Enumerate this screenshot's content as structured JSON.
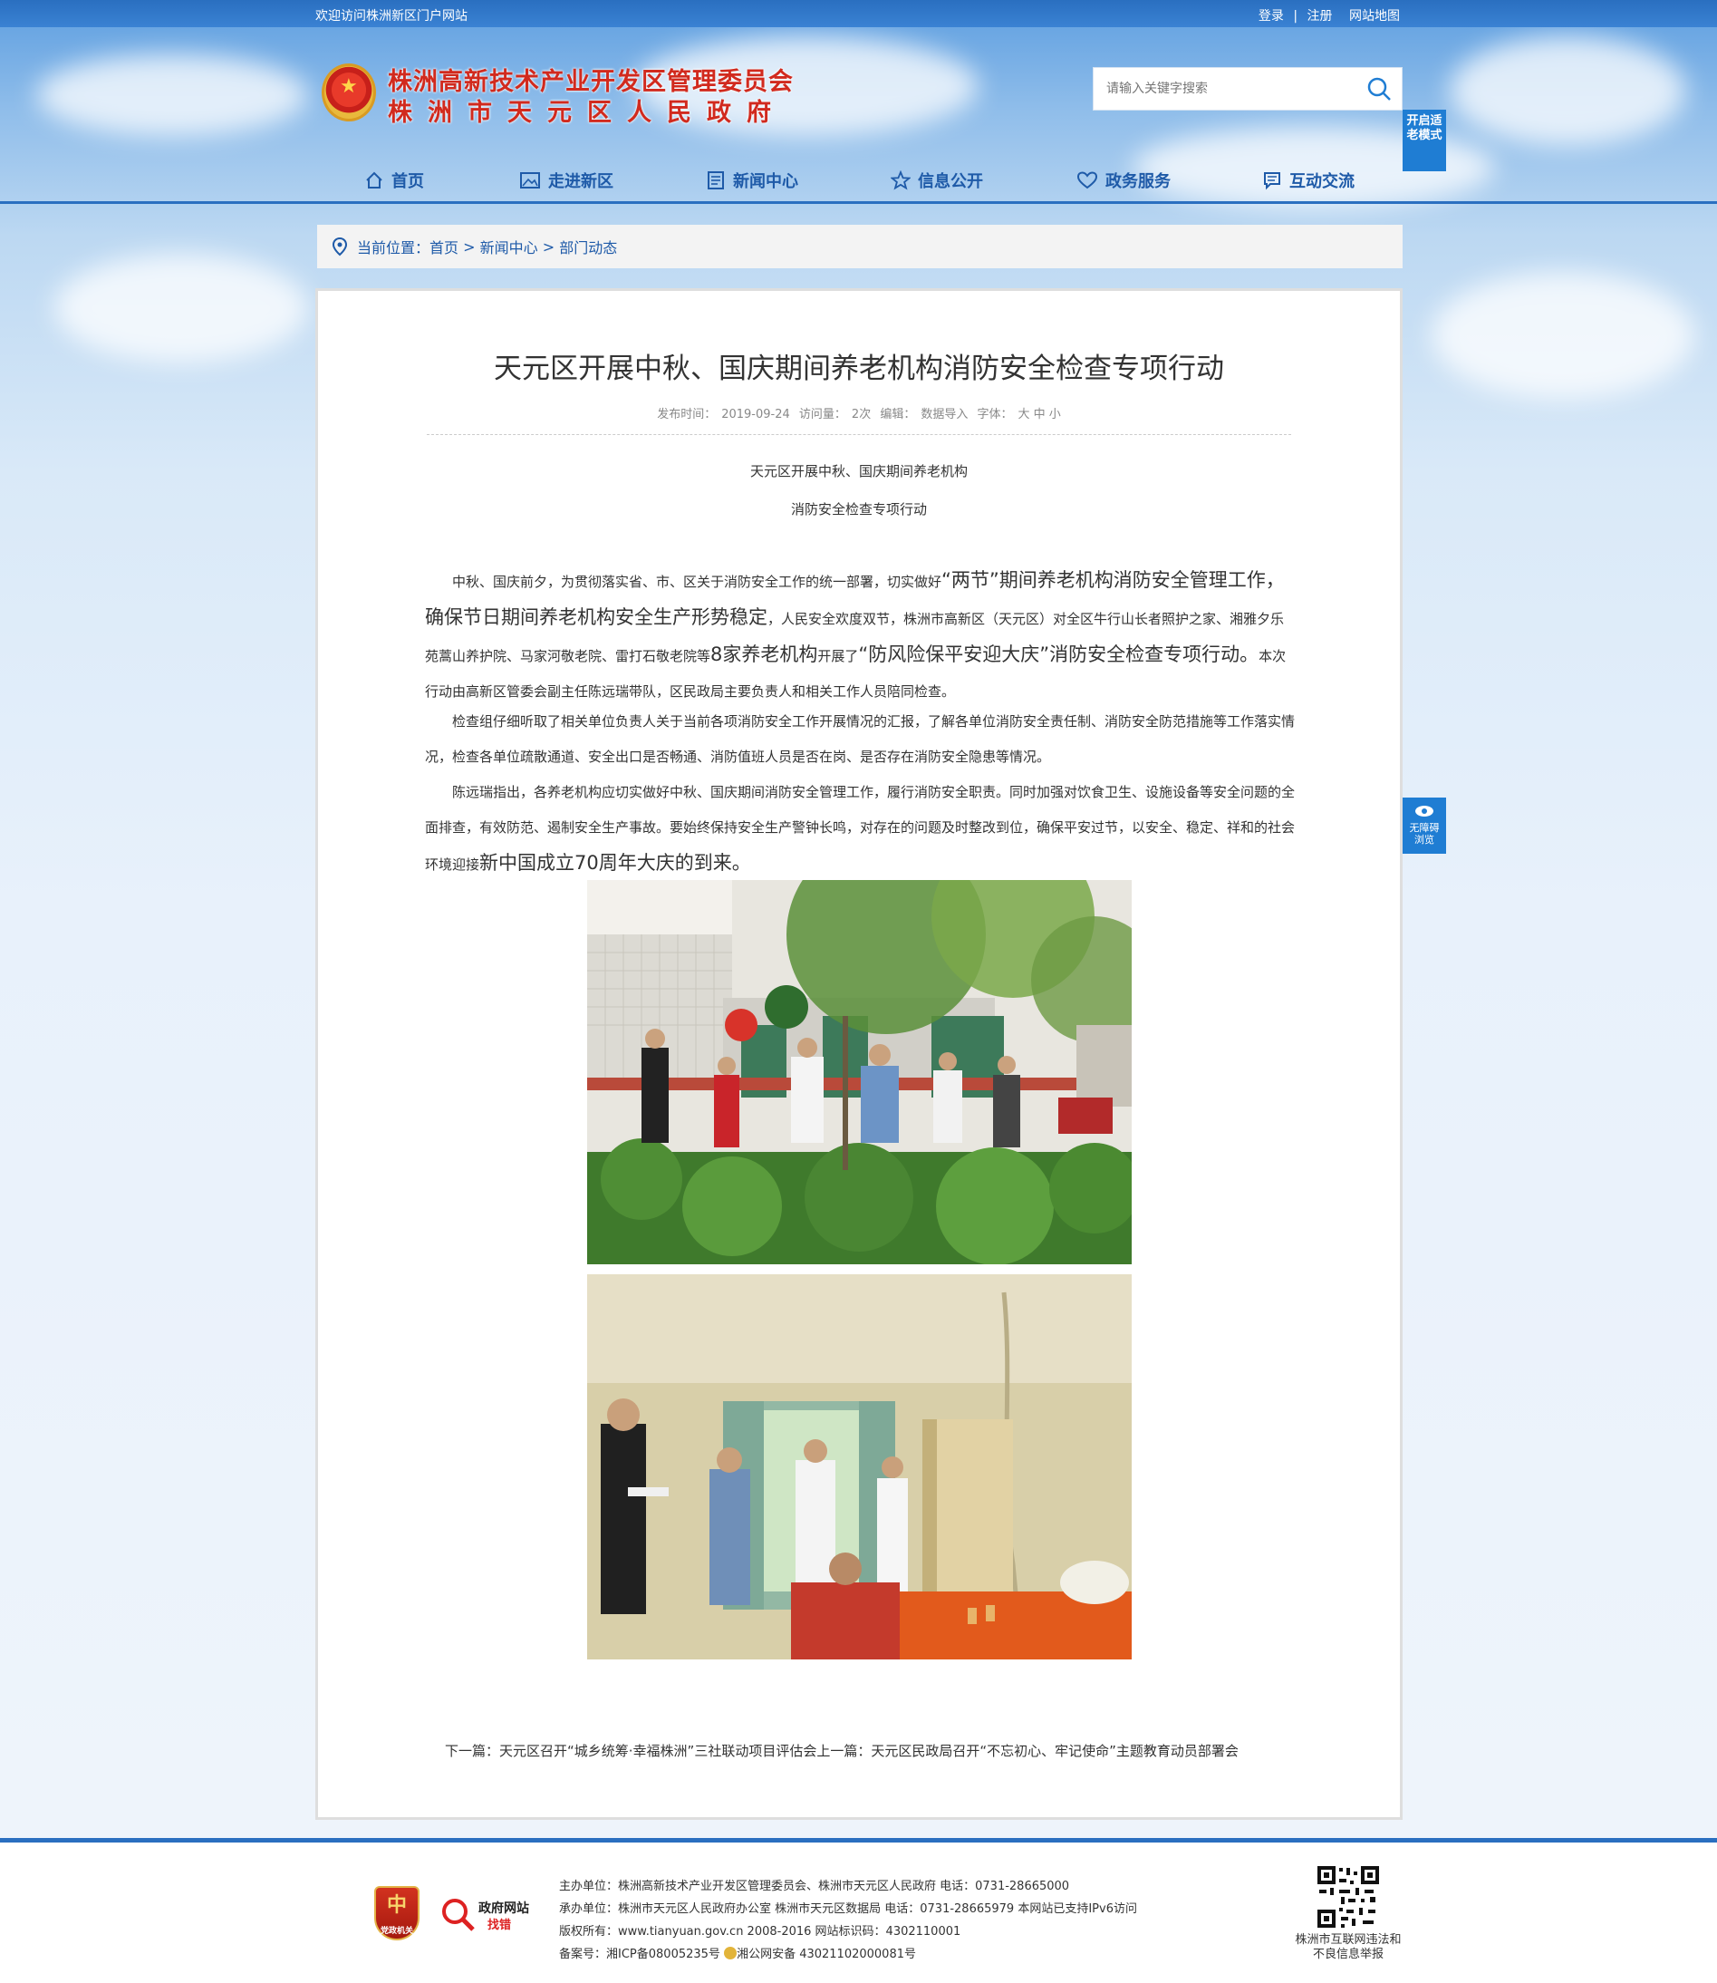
{
  "topbar": {
    "welcome": "欢迎访问株洲新区门户网站",
    "login": "登录",
    "separator": "|",
    "register": "注册",
    "sitemap": "网站地图"
  },
  "header": {
    "title_line1": "株洲高新技术产业开发区管理委员会",
    "title_line2": "株洲市天元区人民政府",
    "search_placeholder": "请输入关键字搜索",
    "elder_mode_label": "开启适老模式"
  },
  "nav": {
    "items": [
      {
        "label": "首页",
        "icon": "home-icon"
      },
      {
        "label": "走进新区",
        "icon": "picture-icon"
      },
      {
        "label": "新闻中心",
        "icon": "newspaper-icon"
      },
      {
        "label": "信息公开",
        "icon": "star-icon"
      },
      {
        "label": "政务服务",
        "icon": "heart-icon"
      },
      {
        "label": "互动交流",
        "icon": "chat-icon"
      }
    ]
  },
  "breadcrumb": {
    "prefix": "当前位置：",
    "home": "首页",
    "sep": " > ",
    "level1": "新闻中心",
    "level2": "部门动态"
  },
  "article": {
    "title": "天元区开展中秋、国庆期间养老机构消防安全检查专项行动",
    "meta": {
      "date_label": "发布时间：",
      "date": "2019-09-24",
      "views_label": "访问量：",
      "views": "2次",
      "editor_label": "编辑：",
      "editor": "数据导入",
      "font_label": "字体：",
      "font_options": "大 中 小"
    },
    "subhead1": "天元区开展中秋、国庆期间养老机构",
    "subhead2": "消防安全检查专项行动",
    "p1_a": "中秋、国庆前夕，为贯彻落实省、市、区关于消防安全工作的统一部署，切实做好",
    "p1_b": "“两节”期间养老机构消防安全管理工作，确保节日期间养老机构安全生产形势稳定",
    "p1_c": "，人民安全欢度双节，株洲市高新区（天元区）对全区牛行山长者照护之家、湘雅夕乐苑蒿山养护院、马家河敬老院、雷打石敬老院等",
    "p1_d": "8家养老机构",
    "p1_e": "开展了",
    "p1_f": "“防风险保平安迎大庆”消防安全检查专项行动。",
    "p1_g": "本次行动由高新区管委会副主任陈远瑞带队，区民政局主要负责人和相关工作人员陪同检查。",
    "p2": "检查组仔细听取了相关单位负责人关于当前各项消防安全工作开展情况的汇报，了解各单位消防安全责任制、消防安全防范措施等工作落实情况，检查各单位疏散通道、安全出口是否畅通、消防值班人员是否在岗、是否存在消防安全隐患等情况。",
    "p3_a": "陈远瑞指出，各养老机构应切实做好中秋、国庆期间消防安全管理工作，履行消防安全职责。同时加强对饮食卫生、设施设备等安全问题的全面排查，有效防范、遏制安全生产事故。要始终保持安全生产警钟长鸣，对存在的问题及时整改到位，确保平安过节，以安全、稳定、祥和的社会环境迎接",
    "p3_b": "新中国成立70周年大庆的到来。",
    "next_label": "下一篇：",
    "next_title": "天元区召开“城乡统筹·幸福株洲”三社联动项目评估会",
    "prev_label": "上一篇：",
    "prev_title": "天元区民政局召开“不忘初心、牢记使命”主题教育动员部署会"
  },
  "side": {
    "accessible_label": "无障碍浏览"
  },
  "footer": {
    "sponsor": "主办单位：株洲高新技术产业开发区管理委员会、株洲市天元区人民政府 电话：0731-28665000",
    "organizer": "承办单位：株洲市天元区人民政府办公室 株洲市天元区数据局 电话：0731-28665979 本网站已支持IPv6访问",
    "copyright": "版权所有：www.tianyuan.gov.cn 2008-2016 网站标识码：4302110001",
    "icp": "备案号：湘ICP备08005235号",
    "police": "湘公网安备 43021102000081号",
    "badge1_char": "中",
    "badge1_caption": "党政机关",
    "badge2_line1": "政府网站",
    "badge2_line2": "找错",
    "qr_caption": "株洲市互联网违法和不良信息举报"
  }
}
